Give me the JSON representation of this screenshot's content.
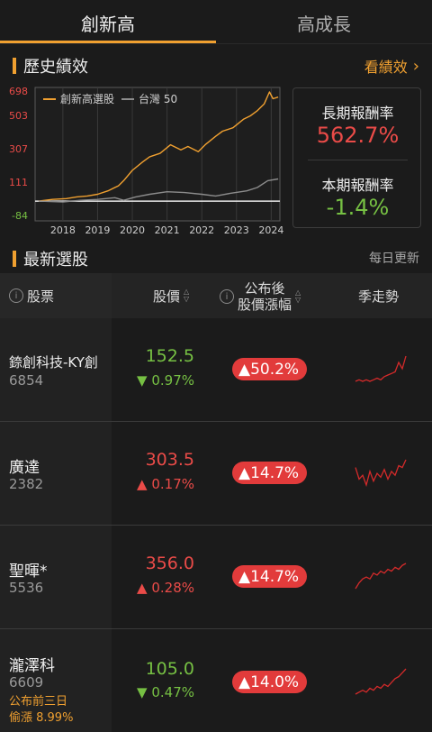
{
  "tabs": [
    {
      "label": "創新高",
      "active": true
    },
    {
      "label": "高成長",
      "active": false
    }
  ],
  "history": {
    "title": "歷史績效",
    "link_label": "看績效",
    "link_icon": "chevron-right-icon"
  },
  "chart_data": {
    "type": "line",
    "x_ticks": [
      "2018",
      "2019",
      "2020",
      "2021",
      "2022",
      "2023",
      "2024"
    ],
    "y_ticks": [
      "698",
      "503",
      "307",
      "111",
      "-84"
    ],
    "ylim": [
      -84,
      698
    ],
    "series": [
      {
        "name": "創新高選股",
        "color": "#f0a030",
        "x": [
          2017.8,
          2018.2,
          2018.6,
          2018.9,
          2019.2,
          2019.5,
          2019.8,
          2020.1,
          2020.25,
          2020.5,
          2020.8,
          2021.0,
          2021.3,
          2021.6,
          2021.9,
          2022.1,
          2022.4,
          2022.6,
          2022.9,
          2023.1,
          2023.4,
          2023.7,
          2023.9,
          2024.1,
          2024.3,
          2024.45,
          2024.55,
          2024.7
        ],
        "y": [
          0,
          10,
          15,
          25,
          30,
          40,
          60,
          90,
          120,
          180,
          230,
          260,
          280,
          330,
          300,
          320,
          290,
          330,
          380,
          410,
          430,
          480,
          500,
          530,
          570,
          640,
          600,
          610
        ]
      },
      {
        "name": "台灣 50",
        "color": "#8c8c8c",
        "x": [
          2017.8,
          2018.5,
          2019.0,
          2019.5,
          2020.0,
          2020.25,
          2020.6,
          2021.0,
          2021.5,
          2022.0,
          2022.5,
          2022.9,
          2023.3,
          2023.8,
          2024.1,
          2024.4,
          2024.7
        ],
        "y": [
          0,
          -5,
          5,
          10,
          20,
          5,
          25,
          40,
          55,
          50,
          40,
          30,
          45,
          60,
          80,
          120,
          130
        ]
      }
    ]
  },
  "returns": {
    "long_label": "長期報酬率",
    "long_value": "562.7%",
    "period_label": "本期報酬率",
    "period_value": "-1.4%"
  },
  "latest": {
    "title": "最新選股",
    "update_note": "每日更新"
  },
  "table": {
    "col_stock": "股票",
    "col_price": "股價",
    "col_change_line1": "公布後",
    "col_change_line2": "股價漲幅",
    "col_trend": "季走勢",
    "rows": [
      {
        "name": "錼創科技-KY創",
        "code": "6854",
        "price": "152.5",
        "change": "▼ 0.97%",
        "dir": "down",
        "since": "▲50.2%",
        "note1": "",
        "note2": "",
        "spark": [
          10,
          11,
          10,
          11,
          10,
          11,
          12,
          11,
          13,
          14,
          15,
          16,
          22,
          18,
          26
        ]
      },
      {
        "name": "廣達",
        "code": "2382",
        "price": "303.5",
        "change": "▲ 0.17%",
        "dir": "up",
        "since": "▲14.7%",
        "note1": "",
        "note2": "",
        "spark": [
          18,
          12,
          14,
          9,
          16,
          11,
          15,
          13,
          17,
          12,
          16,
          14,
          19,
          18,
          22
        ]
      },
      {
        "name": "聖暉*",
        "code": "5536",
        "price": "356.0",
        "change": "▲ 0.28%",
        "dir": "up",
        "since": "▲14.7%",
        "note1": "",
        "note2": "",
        "spark": [
          6,
          9,
          11,
          12,
          11,
          14,
          13,
          15,
          14,
          16,
          15,
          17,
          16,
          18,
          19
        ]
      },
      {
        "name": "瀧澤科",
        "code": "6609",
        "price": "105.0",
        "change": "▼ 0.47%",
        "dir": "down",
        "since": "▲14.0%",
        "note1": "公布前三日",
        "note2": "偷漲 8.99%",
        "spark": [
          5,
          6,
          7,
          6,
          8,
          7,
          9,
          8,
          10,
          9,
          11,
          13,
          14,
          16,
          18
        ]
      }
    ]
  }
}
